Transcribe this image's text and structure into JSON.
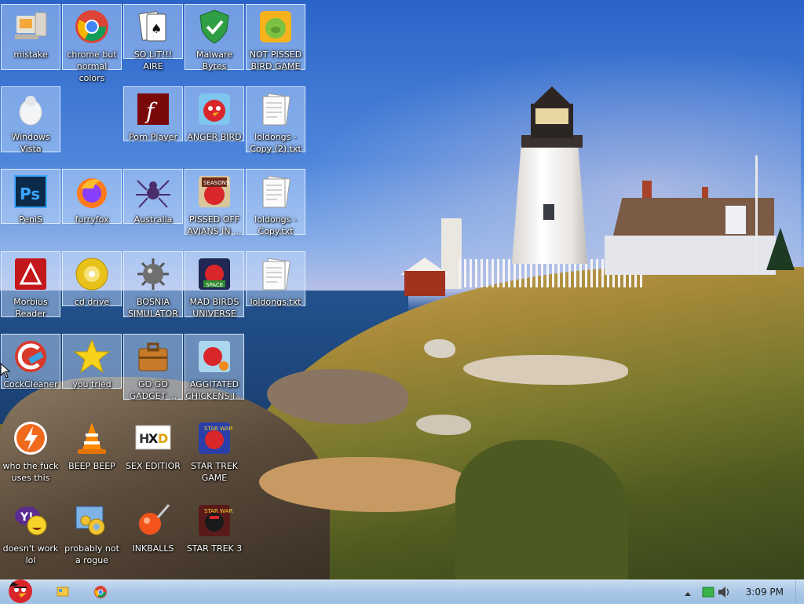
{
  "desktop": {
    "icons": [
      {
        "label": "mistake"
      },
      {
        "label": "chrome but normal colors"
      },
      {
        "label": "SO LIT!!! AIRE"
      },
      {
        "label": "Malware Bytes"
      },
      {
        "label": "NOT PISSED BIRD GAME"
      },
      {
        "label": "Windows Vista"
      },
      {
        "label": "Porn Player"
      },
      {
        "label": "ANGER BIRD"
      },
      {
        "label": "loldongs - Copy (2).txt"
      },
      {
        "label": "PeniS"
      },
      {
        "label": "furryfox"
      },
      {
        "label": "Australia"
      },
      {
        "label": "PISSED OFF AVIANS IN ..."
      },
      {
        "label": "loldongs - Copy.txt"
      },
      {
        "label": "Morbius Reader"
      },
      {
        "label": "cd drive"
      },
      {
        "label": "BOSNIA SIMULATOR"
      },
      {
        "label": "MAD BIRDS UNIVERSE"
      },
      {
        "label": "loldongs.txt"
      },
      {
        "label": "CockCleaner"
      },
      {
        "label": "you tried"
      },
      {
        "label": "GO GO GADGET ..."
      },
      {
        "label": "AGGITATED CHICKENS I..."
      },
      {
        "label": "who the fuck uses this"
      },
      {
        "label": "BEEP BEEP"
      },
      {
        "label": "SEX EDITIOR"
      },
      {
        "label": "STAR TREK GAME"
      },
      {
        "label": "doesn't work lol"
      },
      {
        "label": "probably not a rogue"
      },
      {
        "label": "INKBALLS"
      },
      {
        "label": "STAR TREK 3"
      }
    ]
  },
  "taskbar": {
    "clock": "3:09 PM",
    "tray_icons": [
      "chevron-up-icon",
      "network-icon",
      "volume-icon"
    ],
    "pinned": [
      "file-explorer-icon",
      "chrome-icon"
    ]
  },
  "colors": {
    "taskbar": "#a9c7e6",
    "selection": "#c8e1ff"
  }
}
